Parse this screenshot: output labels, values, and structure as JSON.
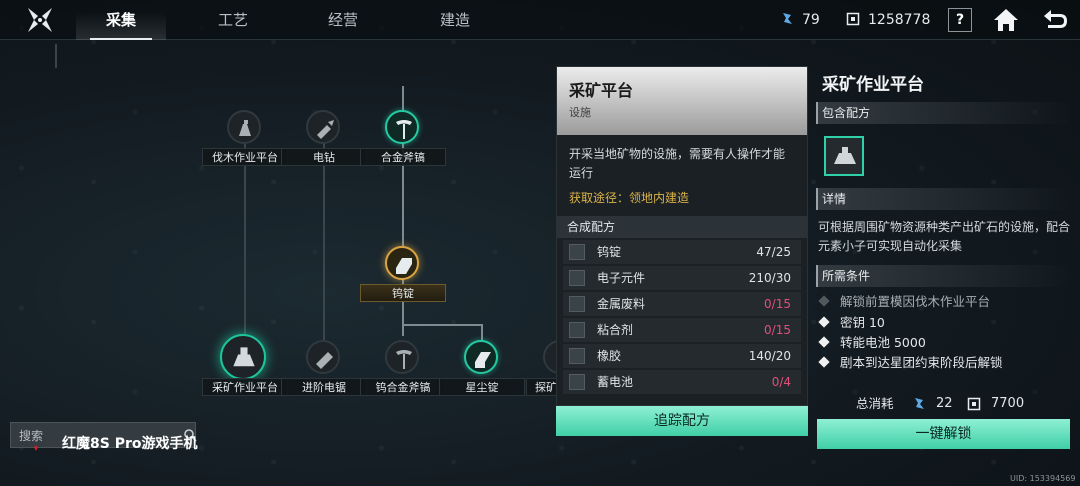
{
  "tabs": [
    {
      "label": "采集",
      "active": true
    },
    {
      "label": "工艺",
      "active": false
    },
    {
      "label": "经营",
      "active": false
    },
    {
      "label": "建造",
      "active": false
    }
  ],
  "resources": {
    "crystal": "79",
    "coins": "1258778"
  },
  "help_label": "?",
  "tree": {
    "nodes": [
      {
        "label": "伐木作业平台",
        "icon": "logging-platform-icon"
      },
      {
        "label": "电钻",
        "icon": "drill-icon"
      },
      {
        "label": "合金斧镐",
        "icon": "alloy-pickaxe-icon"
      },
      {
        "label": "钨锭",
        "icon": "tungsten-ingot-icon"
      },
      {
        "label": "采矿作业平台",
        "icon": "mining-platform-icon"
      },
      {
        "label": "进阶电锯",
        "icon": "chainsaw-icon"
      },
      {
        "label": "钨合金斧镐",
        "icon": "tungsten-pickaxe-icon"
      },
      {
        "label": "星尘锭",
        "icon": "stardust-ingot-icon"
      },
      {
        "label": "探矿",
        "icon": "prospect-icon"
      }
    ]
  },
  "detail": {
    "title": "采矿平台",
    "subtitle": "设施",
    "description": "开采当地矿物的设施，需要有人操作才能运行",
    "source": "获取途径：领地内建造",
    "recipe_header": "合成配方",
    "materials": [
      {
        "name": "钨锭",
        "count": "47/25",
        "insufficient": false
      },
      {
        "name": "电子元件",
        "count": "210/30",
        "insufficient": false
      },
      {
        "name": "金属废料",
        "count": "0/15",
        "insufficient": true
      },
      {
        "name": "粘合剂",
        "count": "0/15",
        "insufficient": true
      },
      {
        "name": "橡胶",
        "count": "140/20",
        "insufficient": false
      },
      {
        "name": "蓄电池",
        "count": "0/4",
        "insufficient": true
      }
    ],
    "track_button": "追踪配方"
  },
  "right": {
    "title": "采矿作业平台",
    "contains_header": "包含配方",
    "details_header": "详情",
    "description": "可根据周围矿物资源种类产出矿石的设施，配合元素小子可实现自动化采集",
    "requirements_header": "所需条件",
    "requirements": [
      {
        "text": "解锁前置模因伐木作业平台",
        "met": false
      },
      {
        "text": "密钥 10",
        "met": true
      },
      {
        "text": "转能电池 5000",
        "met": true
      },
      {
        "text": "剧本到达星团约束阶段后解锁",
        "met": true
      }
    ],
    "total_label": "总消耗",
    "total_crystal": "22",
    "total_coins": "7700",
    "unlock_button": "一键解锁"
  },
  "search_placeholder": "搜索",
  "watermark": "红魔8S Pro游戏手机",
  "uid": "UID: 153394569",
  "colors": {
    "accent": "#3fcfa6",
    "warning": "#e0507a",
    "source": "#d9b24a"
  }
}
